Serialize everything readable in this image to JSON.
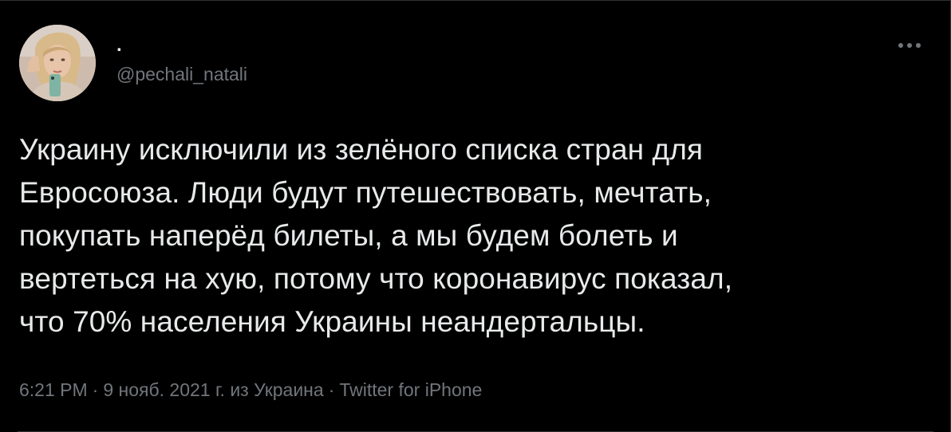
{
  "author": {
    "display_name": ".",
    "handle": "@pechali_natali"
  },
  "tweet": {
    "text_lines": [
      "Украину исключили из зелёного списка стран для",
      "Евросоюза. Люди будут путешествовать, мечтать,",
      "покупать наперёд билеты, а мы будем болеть и",
      "вертеться на хую, потому что коронавирус показал,",
      "что 70% населения Украины неандертальцы."
    ]
  },
  "meta": {
    "time": "6:21 PM",
    "separator": "·",
    "date": "9 нояб. 2021 г. из Украина",
    "source": "Twitter for iPhone"
  },
  "icons": {
    "more": "more-horizontal-icon",
    "avatar": "avatar-photo"
  },
  "colors": {
    "background": "#000000",
    "primary_text": "#e7e9ea",
    "secondary_text": "#71767b",
    "border": "#2f3336"
  }
}
